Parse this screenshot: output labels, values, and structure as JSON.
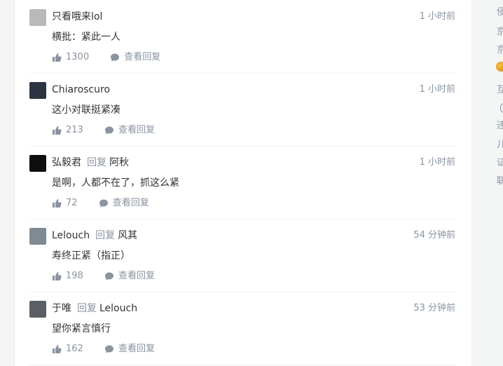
{
  "comments": [
    {
      "user": "只看哦来lol",
      "reply_word": "",
      "reply_target": "",
      "time": "1 小时前",
      "content": "横批：紧此一人",
      "likes": "1300",
      "view_replies": "查看回复",
      "avatar_color": "#b9b9b9"
    },
    {
      "user": "Chiaroscuro",
      "reply_word": "",
      "reply_target": "",
      "time": "1 小时前",
      "content": "这小对联挺紧凑",
      "likes": "213",
      "view_replies": "查看回复",
      "avatar_color": "#2b3440"
    },
    {
      "user": "弘毅君",
      "reply_word": "回复",
      "reply_target": "阿秋",
      "time": "1 小时前",
      "content": "是啊，人都不在了，抓这么紧",
      "likes": "72",
      "view_replies": "查看回复",
      "avatar_color": "#0e0e0e"
    },
    {
      "user": "Lelouch",
      "reply_word": "回复",
      "reply_target": "风其",
      "time": "54 分钟前",
      "content": "寿终正紧（指正）",
      "likes": "198",
      "view_replies": "查看回复",
      "avatar_color": "#7f8a93"
    },
    {
      "user": "于唯",
      "reply_word": "回复",
      "reply_target": "Lelouch",
      "time": "53 分钟前",
      "content": "望你紧言慎行",
      "likes": "162",
      "view_replies": "查看回复",
      "avatar_color": "#5a5f66"
    }
  ],
  "sidebar": {
    "lines": [
      "侵",
      "京",
      "京",
      "",
      "互",
      "(",
      "违",
      "儿",
      "证",
      "联"
    ]
  }
}
